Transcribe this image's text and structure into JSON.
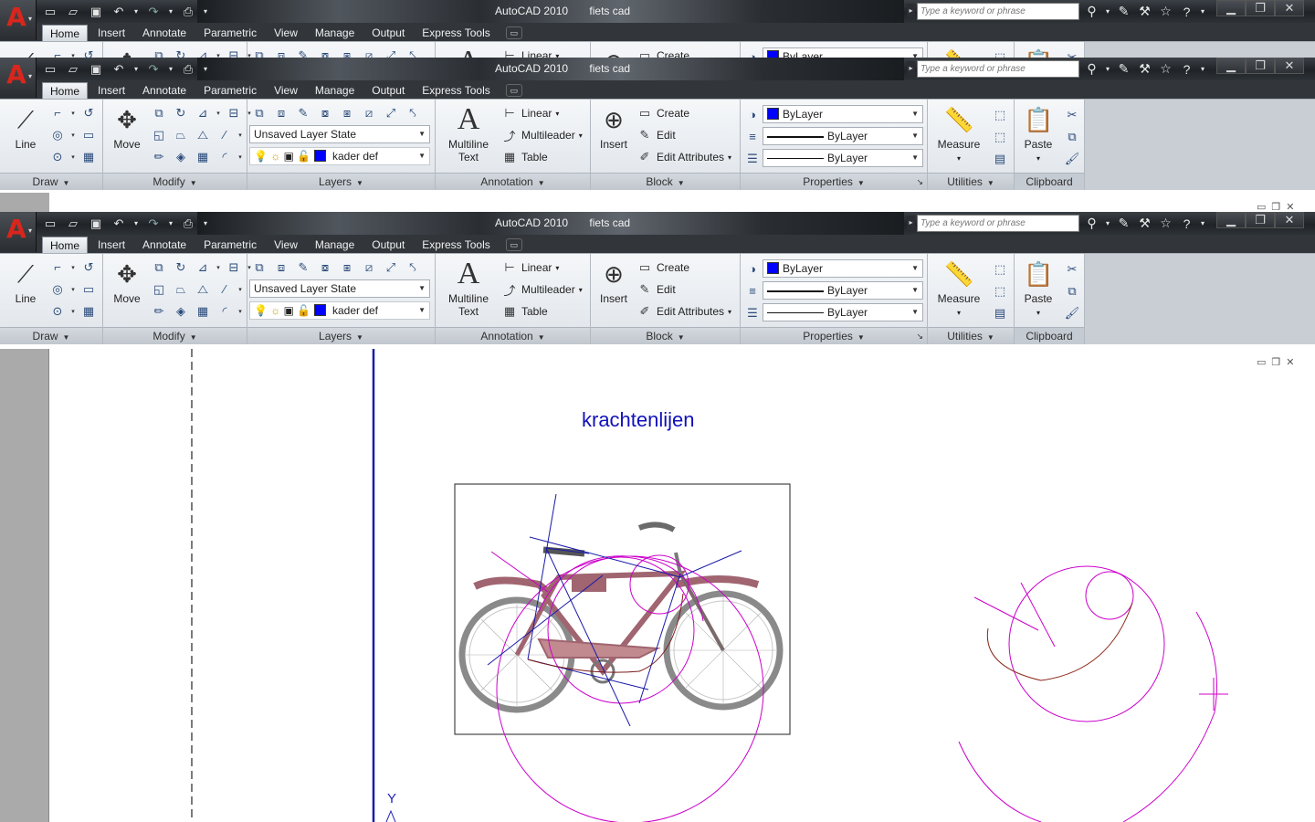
{
  "titlebar": {
    "app": "AutoCAD 2010",
    "file": "fiets cad",
    "search_placeholder": "Type a keyword or phrase"
  },
  "qat": {
    "icons": [
      "new-icon",
      "open-icon",
      "save-icon",
      "undo-icon",
      "redo-icon",
      "plot-icon"
    ]
  },
  "tabs": [
    "Home",
    "Insert",
    "Annotate",
    "Parametric",
    "View",
    "Manage",
    "Output",
    "Express Tools"
  ],
  "ribbon": {
    "draw": {
      "title": "Draw",
      "line": "Line"
    },
    "modify": {
      "title": "Modify",
      "move": "Move"
    },
    "layers": {
      "title": "Layers",
      "layer_state": "Unsaved Layer State",
      "current_layer": "kader def"
    },
    "annotation": {
      "title": "Annotation",
      "text_line1": "Multiline",
      "text_line2": "Text",
      "linear": "Linear",
      "multileader": "Multileader",
      "table": "Table"
    },
    "block": {
      "title": "Block",
      "insert": "Insert",
      "create": "Create",
      "edit": "Edit",
      "edit_attributes": "Edit Attributes"
    },
    "properties": {
      "title": "Properties",
      "color": "ByLayer",
      "lineweight": "ByLayer",
      "linetype": "ByLayer"
    },
    "utilities": {
      "title": "Utilities",
      "measure": "Measure"
    },
    "clipboard": {
      "title": "Clipboard",
      "paste": "Paste"
    }
  },
  "drawing": {
    "heading": "krachtenlijen",
    "ucs_label": "Y"
  },
  "colors": {
    "accent": "#0000ff",
    "force_lines": "#cc00cc",
    "title_text": "#1111bb",
    "ribbon_bg": "#e3e8ed",
    "titlebar_bg": "#25292d"
  }
}
